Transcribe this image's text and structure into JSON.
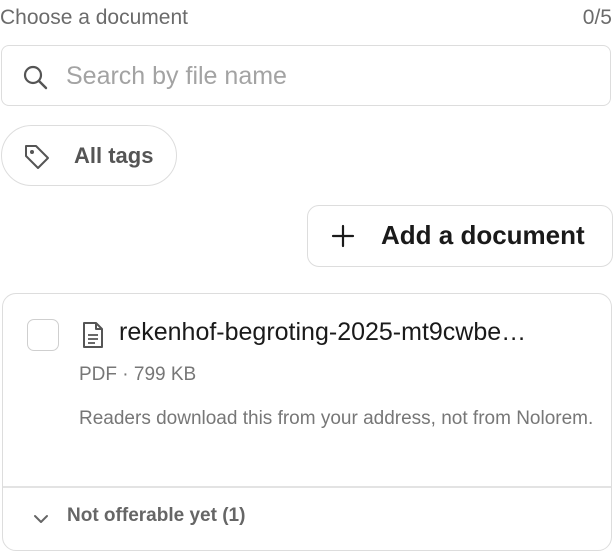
{
  "header": {
    "title": "Choose a document",
    "count": "0/5"
  },
  "search": {
    "icon": "search-icon",
    "placeholder": "Search by file name",
    "value": ""
  },
  "filters": {
    "tags_icon": "tag-icon",
    "tags_label": "All tags"
  },
  "actions": {
    "add_icon": "plus-icon",
    "add_label": "Add a document"
  },
  "documents": [
    {
      "checked": false,
      "icon": "file-icon",
      "name": "rekenhof-begroting-2025-mt9cwbe…",
      "meta": "PDF · 799 KB",
      "note": "Readers download this from your address, not from Nolorem."
    }
  ],
  "group": {
    "icon": "chevron-down-icon",
    "label": "Not offerable yet (1)"
  }
}
